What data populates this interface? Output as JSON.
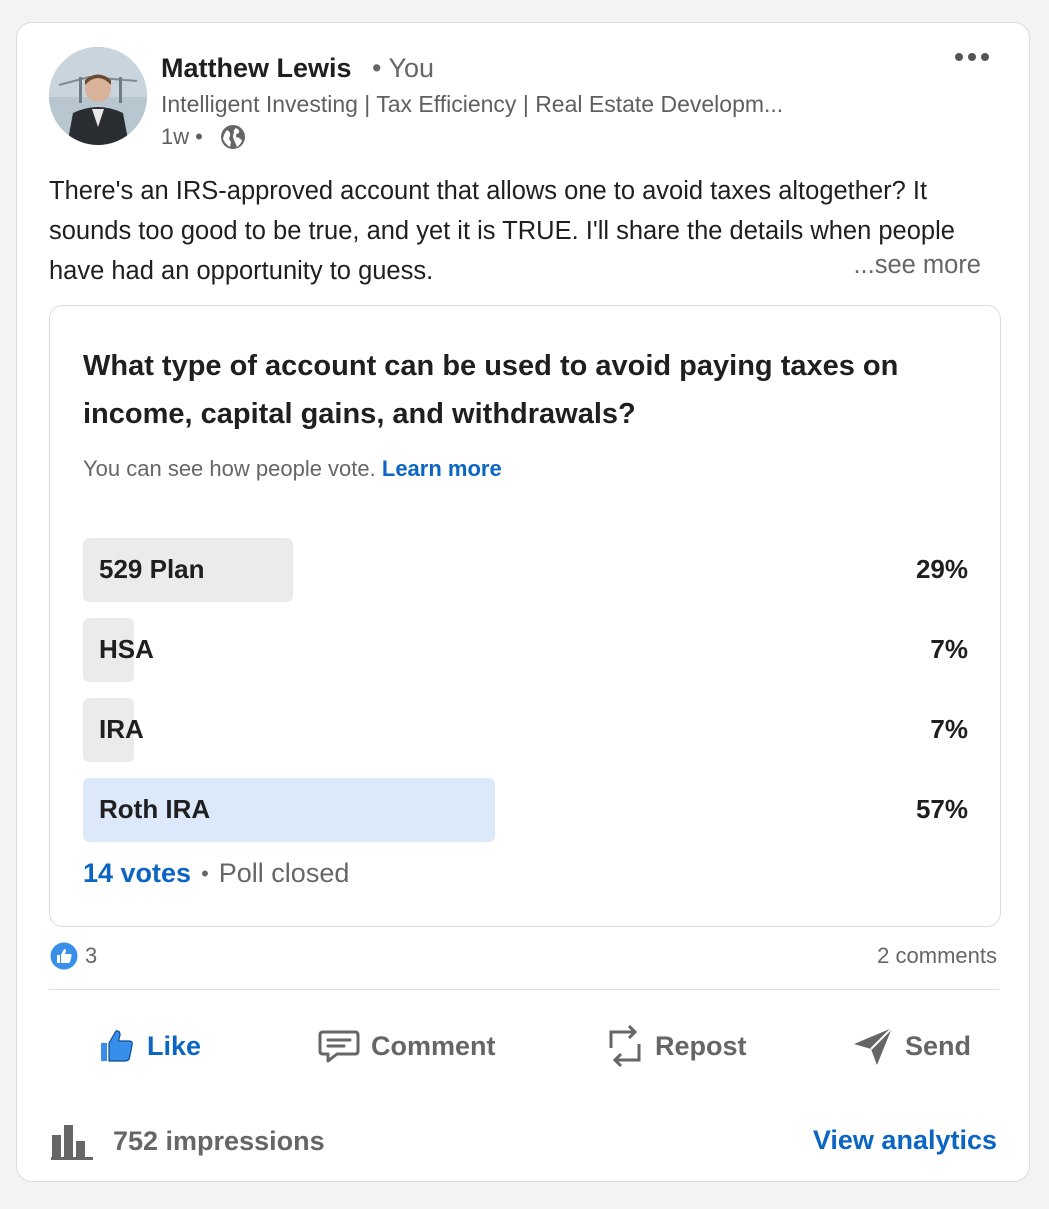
{
  "post": {
    "author": {
      "name": "Matthew Lewis",
      "relation": "• You",
      "headline": "Intelligent Investing | Tax Efficiency | Real Estate Developm...",
      "age": "1w",
      "age_sep": "•"
    },
    "text": "There's an IRS-approved account that allows one to avoid taxes altogether? It sounds too good to be true, and yet it is TRUE. I'll share the details when people have had an opportunity to guess.",
    "see_more": "...see more"
  },
  "poll": {
    "question": "What type of account can be used to avoid paying taxes on income, capital gains, and withdrawals?",
    "notice": "You can see how people vote.",
    "learn_more": "Learn more",
    "options": [
      {
        "label": "529 Plan",
        "percent_text": "29%",
        "percent": 29,
        "winner": false
      },
      {
        "label": "HSA",
        "percent_text": "7%",
        "percent": 7,
        "winner": false
      },
      {
        "label": "IRA",
        "percent_text": "7%",
        "percent": 7,
        "winner": false
      },
      {
        "label": "Roth IRA",
        "percent_text": "57%",
        "percent": 57,
        "winner": true
      }
    ],
    "votes": "14 votes",
    "separator": "•",
    "status": "Poll closed"
  },
  "social": {
    "reaction_count": "3",
    "comments": "2 comments"
  },
  "actions": {
    "like": "Like",
    "comment": "Comment",
    "repost": "Repost",
    "send": "Send"
  },
  "footer": {
    "impressions": "752 impressions",
    "analytics": "View analytics"
  },
  "colors": {
    "accent": "#0a66c2",
    "winner_bar": "#dce9fa",
    "bar": "#ebebeb"
  },
  "icons": [
    "overflow-menu-icon",
    "globe-icon",
    "like-reaction-icon",
    "thumbs-up-icon",
    "comment-icon",
    "repost-icon",
    "send-icon",
    "bar-chart-icon"
  ]
}
